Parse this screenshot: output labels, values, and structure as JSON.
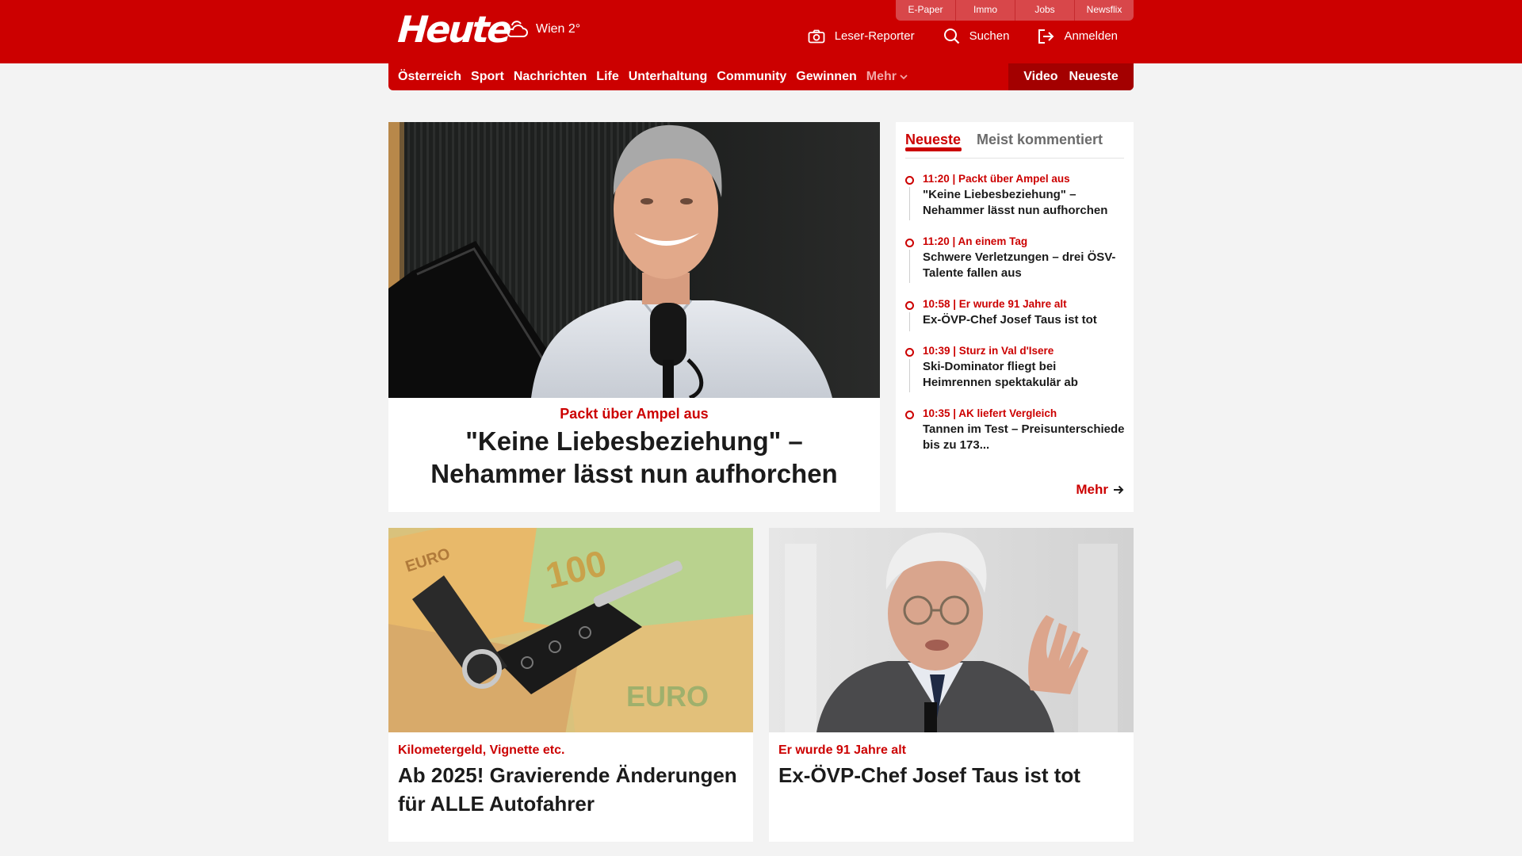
{
  "header": {
    "logo": "Heute",
    "weather": "Wien 2°",
    "top_links": [
      "E-Paper",
      "Immo",
      "Jobs",
      "Newsflix"
    ],
    "actions": {
      "reporter": "Leser-Reporter",
      "search": "Suchen",
      "login": "Anmelden"
    }
  },
  "nav": {
    "items": [
      "Österreich",
      "Sport",
      "Nachrichten",
      "Life",
      "Unterhaltung",
      "Community",
      "Gewinnen"
    ],
    "more": "Mehr",
    "video": "Video",
    "latest": "Neueste"
  },
  "hero": {
    "kicker": "Packt über Ampel aus",
    "headline": "\"Keine Liebesbeziehung\" – Nehammer lässt nun aufhorchen"
  },
  "sidebar": {
    "tab_active": "Neueste",
    "tab_inactive": "Meist kommentiert",
    "items": [
      {
        "meta": "11:20 | Packt über Ampel aus",
        "title": "\"Keine Liebesbeziehung\" – Nehammer lässt nun aufhorchen"
      },
      {
        "meta": "11:20 | An einem Tag",
        "title": "Schwere Verletzungen – drei ÖSV-Talente fallen aus"
      },
      {
        "meta": "10:58 | Er wurde 91 Jahre alt",
        "title": "Ex-ÖVP-Chef Josef Taus ist tot"
      },
      {
        "meta": "10:39 | Sturz in Val d'Isere",
        "title": "Ski-Dominator fliegt bei Heimrennen spektakulär ab"
      },
      {
        "meta": "10:35 | AK liefert Vergleich",
        "title": "Tannen im Test – Preisunterschiede bis zu 173..."
      }
    ],
    "more": "Mehr"
  },
  "cards": [
    {
      "kicker": "Kilometergeld, Vignette etc.",
      "headline": "Ab 2025! Gravierende Änderungen für ALLE Autofahrer"
    },
    {
      "kicker": "Er wurde 91 Jahre alt",
      "headline": "Ex-ÖVP-Chef Josef Taus ist tot"
    }
  ],
  "colors": {
    "brand_red": "#cc0000",
    "dark_red": "#a30000",
    "background": "#f3f3f3"
  }
}
